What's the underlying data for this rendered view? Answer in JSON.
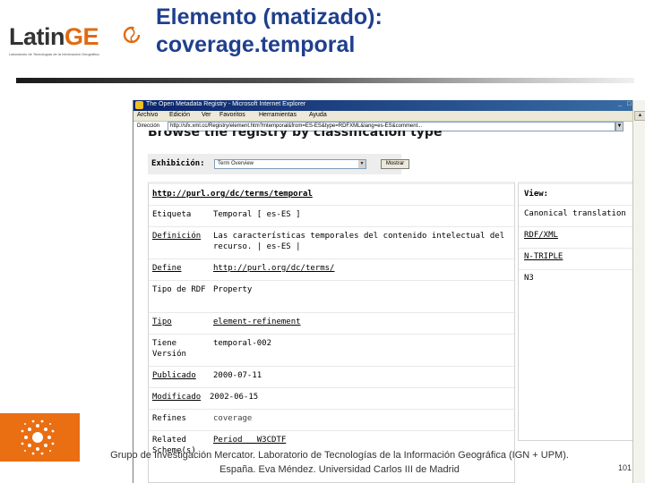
{
  "slide": {
    "logo_part1": "Latin",
    "logo_part2": "GE",
    "logo_tagline": "Laboratorio de Tecnologías de la Información Geográfica",
    "title_line1": "Elemento (matizado):",
    "title_line2": "coverage.temporal",
    "footer_line1": "Grupo de Investigación Mercator. Laboratorio de Tecnologías de la Información Geográfica (IGN + UPM).",
    "footer_line2": "España.  Eva Méndez. Universidad Carlos III de Madrid",
    "page_number": "101"
  },
  "browser": {
    "window_title": "The Open Metadata Registry - Microsoft Internet Explorer",
    "menu": [
      "Archivo",
      "Edición",
      "Ver",
      "Favoritos",
      "Herramientas",
      "Ayuda"
    ],
    "address_label": "Dirección",
    "address_value": "http://sfx.xml.cc/Registry/element.htm?mtemporal&from=ES-ES&type=RDFXML&lang=es-ES&comment...",
    "window_controls": "_ □ X"
  },
  "page": {
    "heading_partial": "Browse the registry by classification type",
    "display_label": "Exhibición:",
    "display_selected": "Term Overview",
    "display_button": "Mostrar",
    "term_uri": "http://purl.org/dc/terms/temporal",
    "rows": [
      {
        "key": "Etiqueta",
        "value": "Temporal [ es-ES ]",
        "key_link": false,
        "value_link": false
      },
      {
        "key": "Definición",
        "value": "Las características temporales del contenido intelectual del recurso. | es-ES |",
        "key_link": true,
        "value_link": false
      },
      {
        "key": "Define",
        "value": "http://purl.org/dc/terms/",
        "key_link": true,
        "value_link": true
      },
      {
        "key": "Tipo de RDF",
        "value": "Property",
        "key_link": false,
        "value_link": false
      },
      {
        "key": "Tipo",
        "value": "element-refinement",
        "key_link": true,
        "value_link": true
      },
      {
        "key": "Tiene Versión",
        "value": "temporal-002",
        "key_link": false,
        "value_link": false
      },
      {
        "key": "Publicado",
        "value": "2000-07-11",
        "key_link": true,
        "value_link": false
      },
      {
        "key": "Modificado",
        "value": "2002-06-15",
        "key_link": true,
        "value_link": false
      },
      {
        "key": "Refines",
        "value": "coverage",
        "key_link": false,
        "value_link": false
      },
      {
        "key": "Related Scheme(s)",
        "value": "Period   W3CDTF",
        "key_link": false,
        "value_link": true
      }
    ],
    "view": {
      "header": "View:",
      "items": [
        "Canonical translation",
        "RDF/XML",
        "N-TRIPLE",
        "N3"
      ]
    }
  },
  "colors": {
    "title_blue": "#1f3f8e",
    "brand_orange": "#e06a12",
    "ie_titlebar": "#0a246a"
  },
  "icons": [
    "sun-logo-icon",
    "ie-logo-icon",
    "swirl-logo-icon"
  ]
}
